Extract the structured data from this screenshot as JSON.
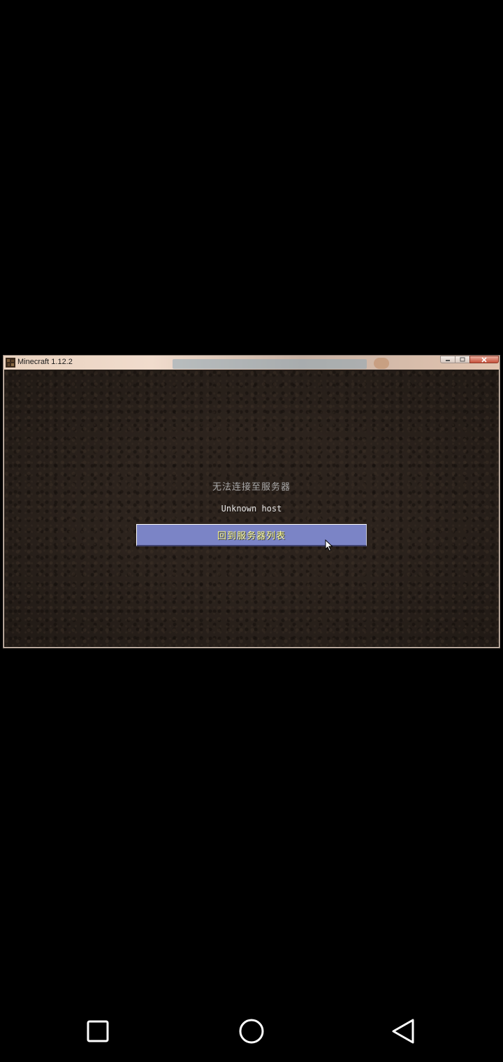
{
  "window": {
    "title": "Minecraft 1.12.2",
    "icon": "minecraft-icon",
    "controls": [
      "minimize-icon",
      "maximize-icon",
      "close-icon"
    ]
  },
  "game": {
    "error_title": "无法连接至服务器",
    "error_detail": "Unknown host",
    "back_button_label": "回到服务器列表"
  },
  "navbar": {
    "buttons": [
      "recents-icon",
      "home-icon",
      "back-icon"
    ]
  },
  "colors": {
    "button_bg": "#7b84c6",
    "button_text": "#ffffa0",
    "background": "#2c231d"
  }
}
